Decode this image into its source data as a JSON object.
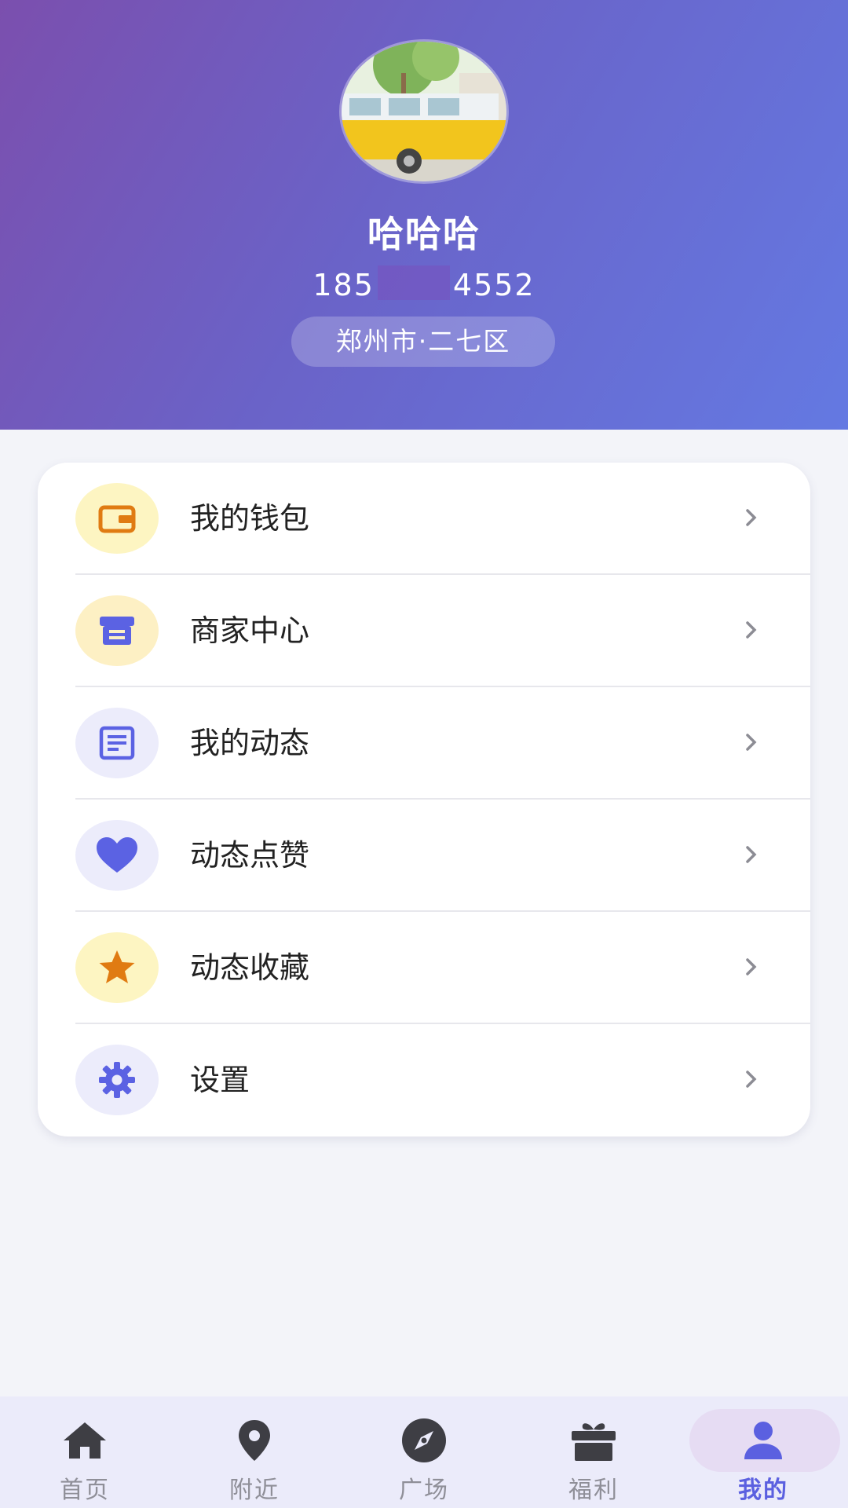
{
  "profile": {
    "name": "哈哈哈",
    "phone_prefix": "185",
    "phone_suffix": "4552",
    "location": "郑州市·二七区"
  },
  "colors": {
    "header_gradient": [
      "#7b4fae",
      "#6a63c8",
      "#6479e2"
    ],
    "accent": "#5b60e0",
    "icon_orange": "#e07b12",
    "icon_blue": "#5b62e3"
  },
  "menu": {
    "items": [
      {
        "label": "我的钱包",
        "icon": "wallet-icon"
      },
      {
        "label": "商家中心",
        "icon": "store-icon"
      },
      {
        "label": "我的动态",
        "icon": "article-icon"
      },
      {
        "label": "动态点赞",
        "icon": "heart-icon"
      },
      {
        "label": "动态收藏",
        "icon": "star-icon"
      },
      {
        "label": "设置",
        "icon": "gear-icon"
      }
    ]
  },
  "nav": {
    "items": [
      {
        "label": "首页",
        "icon": "home-icon",
        "active": false
      },
      {
        "label": "附近",
        "icon": "location-pin-icon",
        "active": false
      },
      {
        "label": "广场",
        "icon": "compass-icon",
        "active": false
      },
      {
        "label": "福利",
        "icon": "gift-icon",
        "active": false
      },
      {
        "label": "我的",
        "icon": "person-icon",
        "active": true
      }
    ]
  }
}
